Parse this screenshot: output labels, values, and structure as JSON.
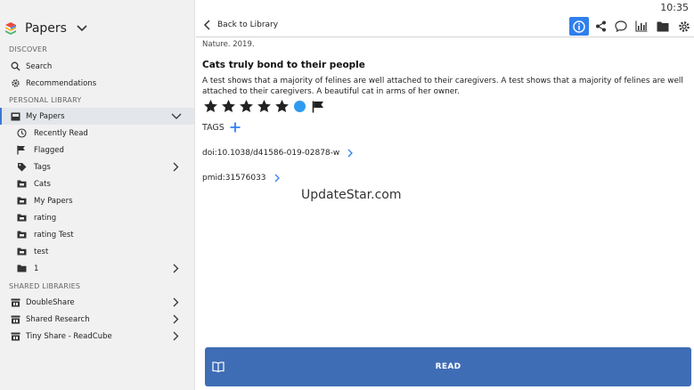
{
  "status": {
    "time": "10:35"
  },
  "app": {
    "name": "Papers"
  },
  "sidebar": {
    "discover_label": "DISCOVER",
    "discover": [
      {
        "label": "Search",
        "icon": "search-icon"
      },
      {
        "label": "Recommendations",
        "icon": "gear-icon"
      }
    ],
    "personal_label": "PERSONAL LIBRARY",
    "my_papers": {
      "label": "My Papers",
      "icon": "inbox-icon"
    },
    "personal_items": [
      {
        "label": "Recently Read",
        "icon": "clock-icon"
      },
      {
        "label": "Flagged",
        "icon": "flag-icon"
      },
      {
        "label": "Tags",
        "icon": "tag-icon"
      },
      {
        "label": "Cats",
        "icon": "folder-icon"
      },
      {
        "label": "My Papers",
        "icon": "folder-icon"
      },
      {
        "label": "rating",
        "icon": "folder-icon"
      },
      {
        "label": "rating Test",
        "icon": "folder-icon"
      },
      {
        "label": "test",
        "icon": "folder-icon"
      },
      {
        "label": "1",
        "icon": "folder-icon"
      }
    ],
    "shared_label": "SHARED LIBRARIES",
    "shared_items": [
      {
        "label": "DoubleShare",
        "icon": "shared-library-icon"
      },
      {
        "label": "Shared Research",
        "icon": "shared-library-icon"
      },
      {
        "label": "Tiny Share - ReadCube",
        "icon": "shared-library-icon"
      }
    ]
  },
  "toolbar": {
    "back_label": "Back to Library",
    "icons": [
      "info-icon",
      "share-icon",
      "comment-icon",
      "chart-icon",
      "folder-icon",
      "settings-icon"
    ]
  },
  "paper": {
    "source": "Nature. 2019.",
    "title": "Cats truly bond to their people",
    "abstract": "A test shows that a majority of felines are well attached to their caregivers. A test shows that a majority of felines are well attached to their caregivers. A beautiful cat in arms of her owner.",
    "rating": 5,
    "rating_max": 5,
    "color_label": "#2f9bf0",
    "flagged": true,
    "tags_label": "TAGS",
    "doi": "doi:10.1038/d41586-019-02878-w",
    "pmid": "pmid:31576033"
  },
  "watermark": "UpdateStar.com",
  "read_button": {
    "label": "READ"
  },
  "colors": {
    "accent": "#2f80ed",
    "read_button": "#3f6db5"
  }
}
